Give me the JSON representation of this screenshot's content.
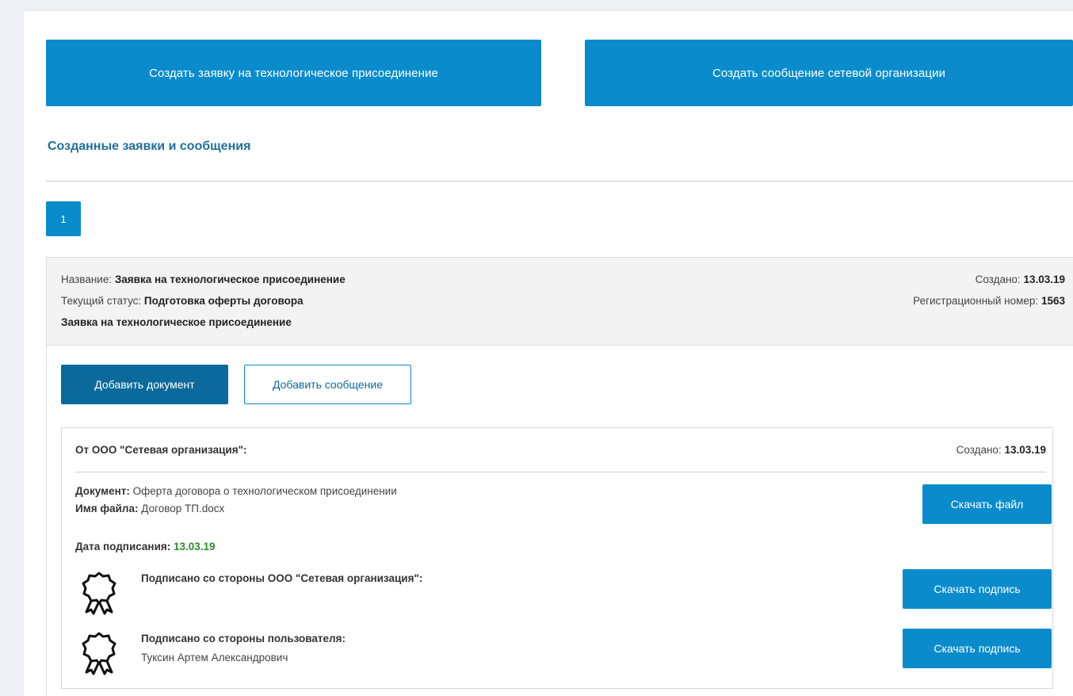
{
  "actions": {
    "create_request": "Создать заявку на технологическое присоединение",
    "create_message": "Создать сообщение сетевой организации"
  },
  "section_title": "Созданные заявки и сообщения",
  "pagination": {
    "current_page": "1"
  },
  "request": {
    "name_label": "Название: ",
    "name_value": "Заявка на технологическое присоединение",
    "status_label": "Текущий статус: ",
    "status_value": "Подготовка оферты договора",
    "subtitle": "Заявка на технологическое присоединение",
    "created_label": "Создано: ",
    "created_value": "13.03.19",
    "reg_label": "Регистрационный номер: ",
    "reg_value": "1563",
    "add_document": "Добавить документ",
    "add_message": "Добавить сообщение"
  },
  "message": {
    "from": "От ООО \"Сетевая организация\":",
    "created_label": "Создано: ",
    "created_value": "13.03.19",
    "doc_label": "Документ:",
    "doc_value": " Оферта договора о технологическом присоединении",
    "file_label": "Имя файла:",
    "file_value": " Договор ТП.docx",
    "download_file": "Скачать файл",
    "sign_date_label": "Дата подписания: ",
    "sign_date_value": "13.03.19",
    "signatures": [
      {
        "title": "Подписано со стороны ООО \"Сетевая организация\":",
        "name": "",
        "download": "Скачать подпись",
        "icon": "award-seal-icon"
      },
      {
        "title": "Подписано со стороны пользователя:",
        "name": "Туксин Артем Александрович",
        "download": "Скачать подпись",
        "icon": "award-seal-icon"
      }
    ]
  },
  "colors": {
    "primary": "#0a8ccc",
    "primary_dark": "#0b6a9b",
    "title": "#1f6f99",
    "success": "#2e8b2e",
    "background": "#eef0f4"
  }
}
